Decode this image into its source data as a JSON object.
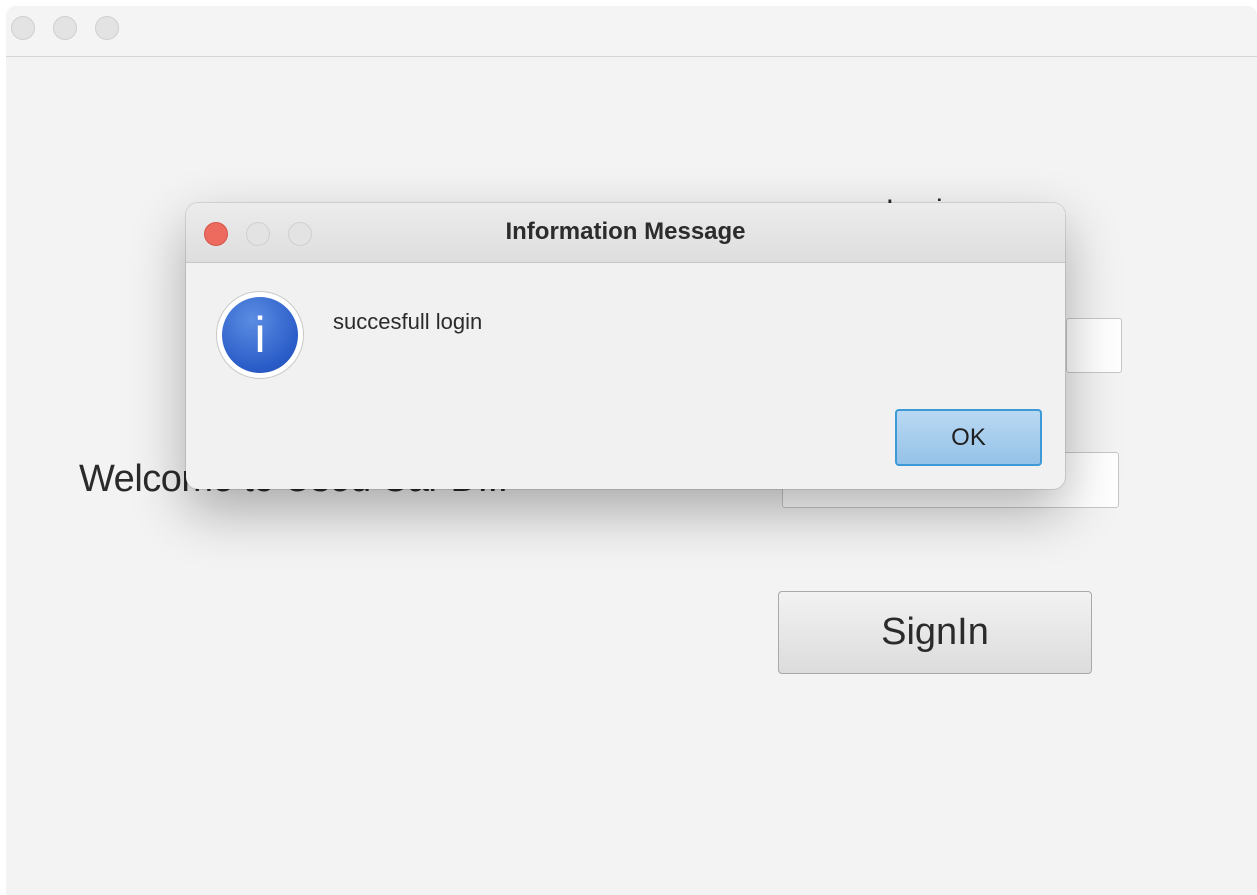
{
  "main_window": {
    "welcome_text": "Welcome to Used Car D...",
    "heading_fragment": "Login",
    "password_mask": "••••••••••",
    "signin_label": "SignIn"
  },
  "dialog": {
    "title": "Information Message",
    "icon": "info-icon",
    "icon_glyph": "i",
    "message": "succesfull login",
    "ok_label": "OK",
    "close_color": "#ec6a5e",
    "accent_color": "#3e9ad6"
  }
}
